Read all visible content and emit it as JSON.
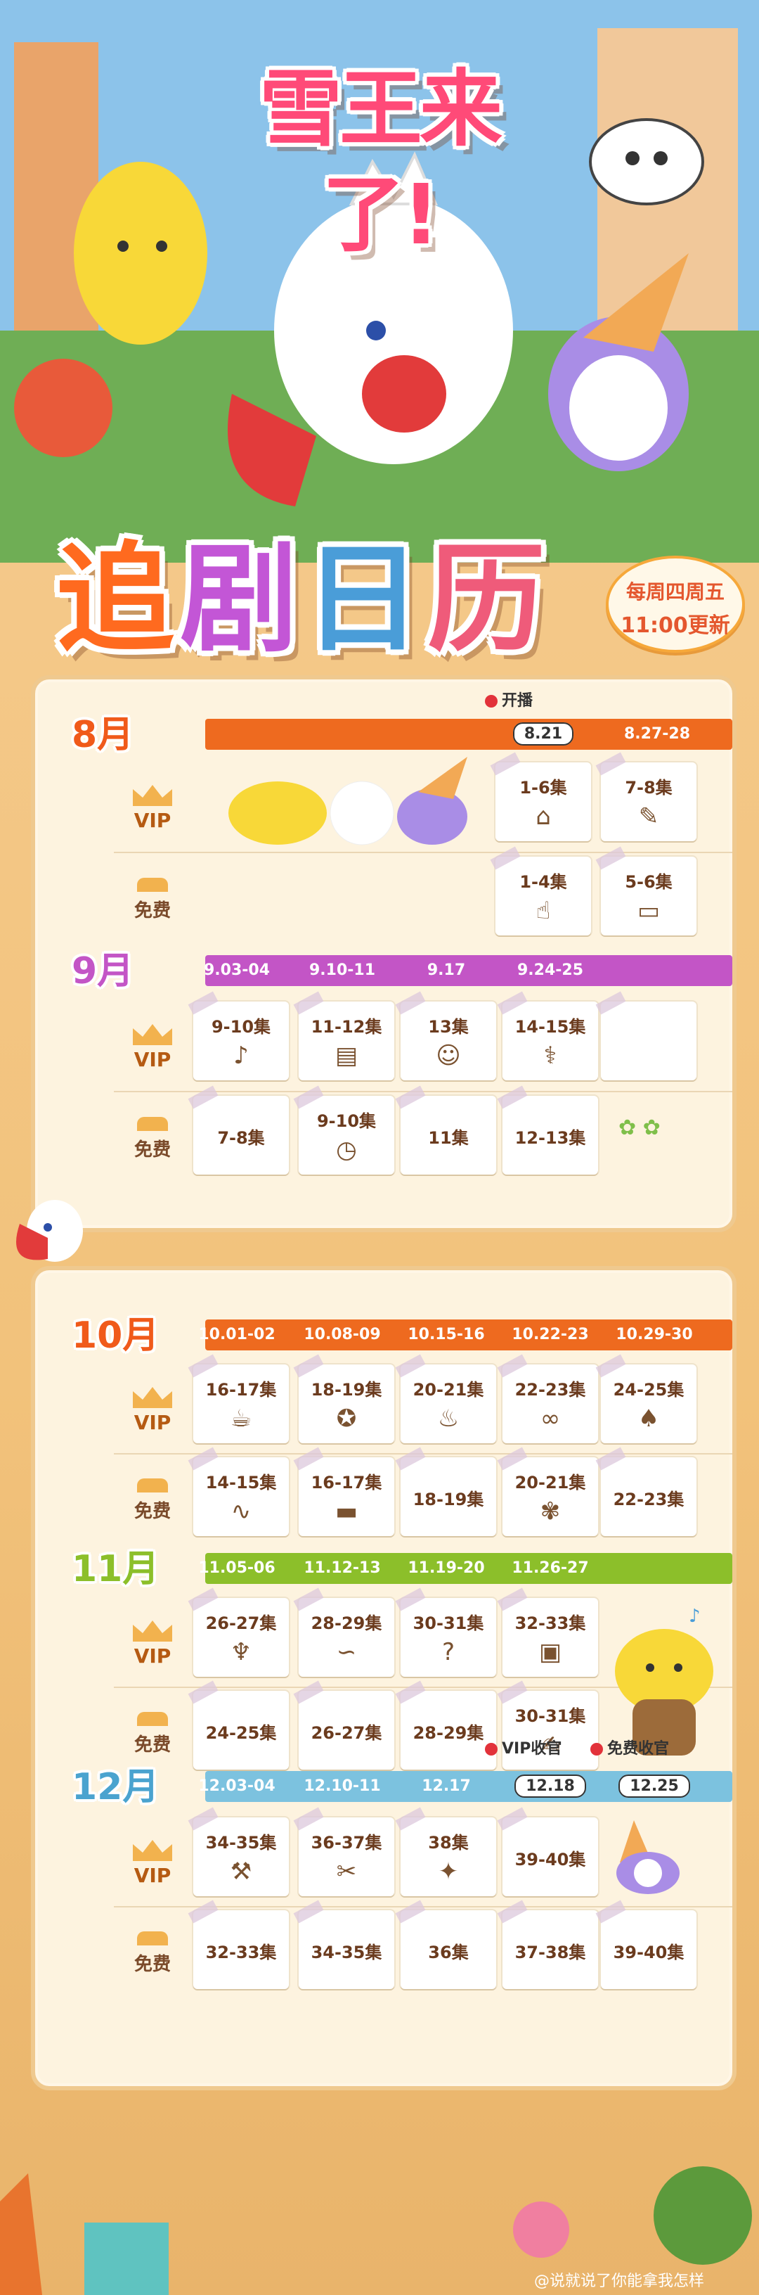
{
  "logo": {
    "text": "雪王来了!"
  },
  "title": {
    "chars": [
      "追",
      "剧",
      "日",
      "历"
    ]
  },
  "update": {
    "line1": "每周四周五",
    "line2": "11:00更新"
  },
  "labels": {
    "vip": "VIP",
    "free": "免费"
  },
  "months": {
    "aug": {
      "label": "8月",
      "dates": [
        "8.21",
        "8.27-28"
      ],
      "marker": "开播",
      "vip": [
        "1-6集",
        "7-8集"
      ],
      "free": [
        "1-4集",
        "5-6集"
      ]
    },
    "sep": {
      "label": "9月",
      "dates": [
        "9.03-04",
        "9.10-11",
        "9.17",
        "9.24-25"
      ],
      "vip": [
        "9-10集",
        "11-12集",
        "13集",
        "14-15集"
      ],
      "free": [
        "7-8集",
        "9-10集",
        "11集",
        "12-13集"
      ]
    },
    "oct": {
      "label": "10月",
      "dates": [
        "10.01-02",
        "10.08-09",
        "10.15-16",
        "10.22-23",
        "10.29-30"
      ],
      "vip": [
        "16-17集",
        "18-19集",
        "20-21集",
        "22-23集",
        "24-25集"
      ],
      "free": [
        "14-15集",
        "16-17集",
        "18-19集",
        "20-21集",
        "22-23集"
      ]
    },
    "nov": {
      "label": "11月",
      "dates": [
        "11.05-06",
        "11.12-13",
        "11.19-20",
        "11.26-27"
      ],
      "vip": [
        "26-27集",
        "28-29集",
        "30-31集",
        "32-33集"
      ],
      "free": [
        "24-25集",
        "26-27集",
        "28-29集",
        "30-31集"
      ]
    },
    "dec": {
      "label": "12月",
      "dates": [
        "12.03-04",
        "12.10-11",
        "12.17",
        "12.18",
        "12.25"
      ],
      "markers": [
        "VIP收官",
        "免费收官"
      ],
      "vip": [
        "34-35集",
        "36-37集",
        "38集",
        "39-40集"
      ],
      "free": [
        "32-33集",
        "34-35集",
        "36集",
        "37-38集",
        "39-40集"
      ]
    }
  },
  "colors": {
    "aug": "#ee6a1f",
    "sep": "#c355c6",
    "oct": "#ee6a1f",
    "nov": "#8cbf2a",
    "dec": "#7cc2df"
  },
  "watermark": "@说就说了你能拿我怎样"
}
